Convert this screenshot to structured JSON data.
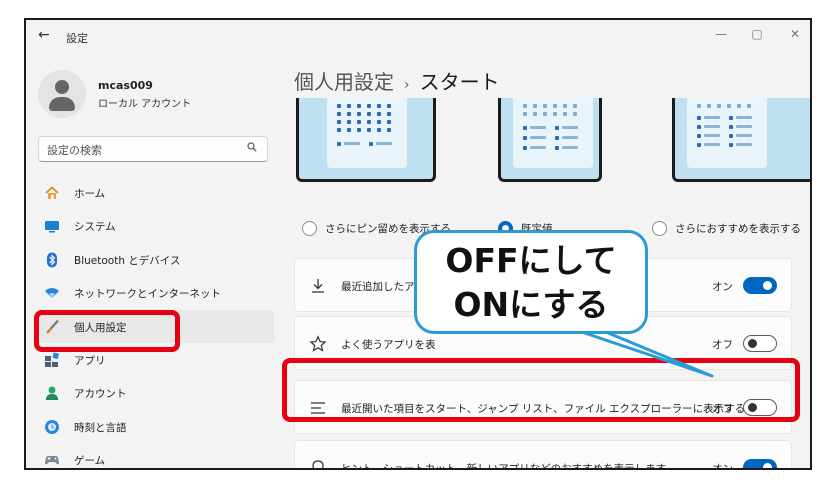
{
  "app": {
    "title": "設定",
    "back_icon": "arrow-left-icon"
  },
  "window_controls": {
    "minimize": "—",
    "maximize": "▢",
    "close": "✕"
  },
  "profile": {
    "name": "mcas009",
    "account_type": "ローカル アカウント"
  },
  "search": {
    "placeholder": "設定の検索"
  },
  "nav": [
    {
      "label": "ホーム",
      "icon": "home-icon"
    },
    {
      "label": "システム",
      "icon": "monitor-icon"
    },
    {
      "label": "Bluetooth とデバイス",
      "icon": "bluetooth-icon"
    },
    {
      "label": "ネットワークとインターネット",
      "icon": "wifi-icon"
    },
    {
      "label": "個人用設定",
      "icon": "brush-icon",
      "active": true
    },
    {
      "label": "アプリ",
      "icon": "apps-icon"
    },
    {
      "label": "アカウント",
      "icon": "person-icon"
    },
    {
      "label": "時刻と言語",
      "icon": "globe-clock-icon"
    },
    {
      "label": "ゲーム",
      "icon": "gamepad-icon"
    }
  ],
  "header": {
    "section": "個人用設定",
    "separator": "›",
    "page": "スタート"
  },
  "layout_options": [
    {
      "label": "さらにピン留めを表示する",
      "selected": false
    },
    {
      "label": "既定値",
      "selected": true
    },
    {
      "label": "さらにおすすめを表示する",
      "selected": false
    }
  ],
  "settings": [
    {
      "label": "最近追加したアプリを表示する",
      "visible_label": "最近追加したア",
      "icon": "download-icon",
      "state": "オン",
      "on": true
    },
    {
      "label": "よく使うアプリを表示する",
      "visible_label": "よく使うアプリを表",
      "icon": "star-icon",
      "state": "オフ",
      "on": false
    },
    {
      "label": "最近開いた項目をスタート、ジャンプ リスト、ファイル エクスプローラーに表示する",
      "icon": "list-icon",
      "state": "オフ",
      "on": false
    },
    {
      "label": "ヒント、ショートカット、新しいアプリなどのおすすめを表示します",
      "icon": "lightbulb-icon",
      "state": "オン",
      "on": true
    }
  ],
  "callout": {
    "line1": "OFFにして",
    "line2": "ONにする"
  },
  "colors": {
    "accent": "#0067c0",
    "highlight": "#e60012",
    "callout_border": "#2b9bd6"
  }
}
